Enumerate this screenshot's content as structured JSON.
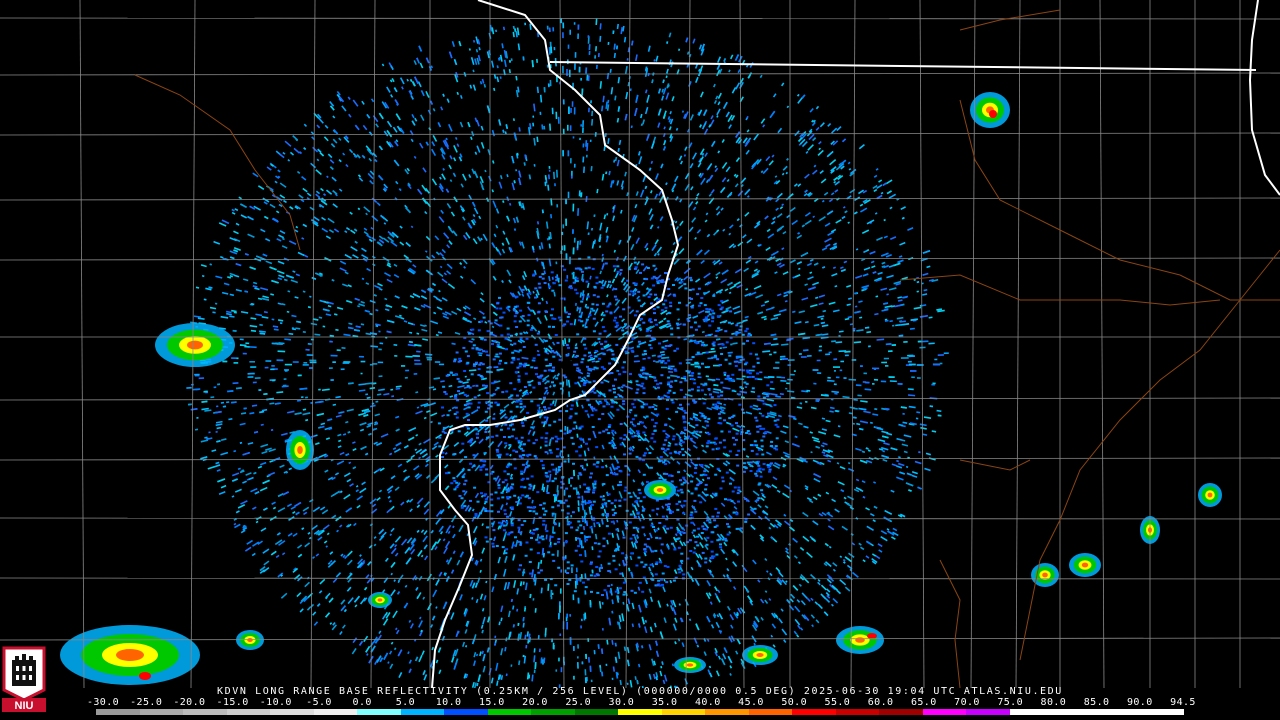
{
  "title": "KDVN LONG RANGE BASE REFLECTIVITY (0.25KM / 256 LEVEL) (000000/0000 0.5 DEG) 2025-06-30 19:04 UTC  ATLAS.NIU.EDU",
  "logo_text": "NIU",
  "scale": {
    "labels": [
      "-30.0",
      "-25.0",
      "-20.0",
      "-15.0",
      "-10.0",
      "-5.0",
      "0.0",
      "5.0",
      "10.0",
      "15.0",
      "20.0",
      "25.0",
      "30.0",
      "35.0",
      "40.0",
      "45.0",
      "50.0",
      "55.0",
      "60.0",
      "65.0",
      "70.0",
      "75.0",
      "80.0",
      "85.0",
      "90.0",
      "94.5"
    ],
    "colors": [
      "#9a9a9a",
      "#aaaaaa",
      "#bbbbbb",
      "#cccccc",
      "#dddddd",
      "#eeeeee",
      "#7fffff",
      "#00b4ff",
      "#0050ff",
      "#00c800",
      "#00a000",
      "#007800",
      "#ffff00",
      "#ffd200",
      "#ff9600",
      "#ff6400",
      "#ff0000",
      "#c80000",
      "#a00000",
      "#ff00ff",
      "#c800ff",
      "#ffffff",
      "#ffffff",
      "#ffffff",
      "#ffffff"
    ]
  },
  "colors": {
    "background": "#000000",
    "county_lines": "#8a8a8a",
    "state_lines": "#ffffff",
    "highways": "#8b4513",
    "radar_site": "#000000"
  }
}
